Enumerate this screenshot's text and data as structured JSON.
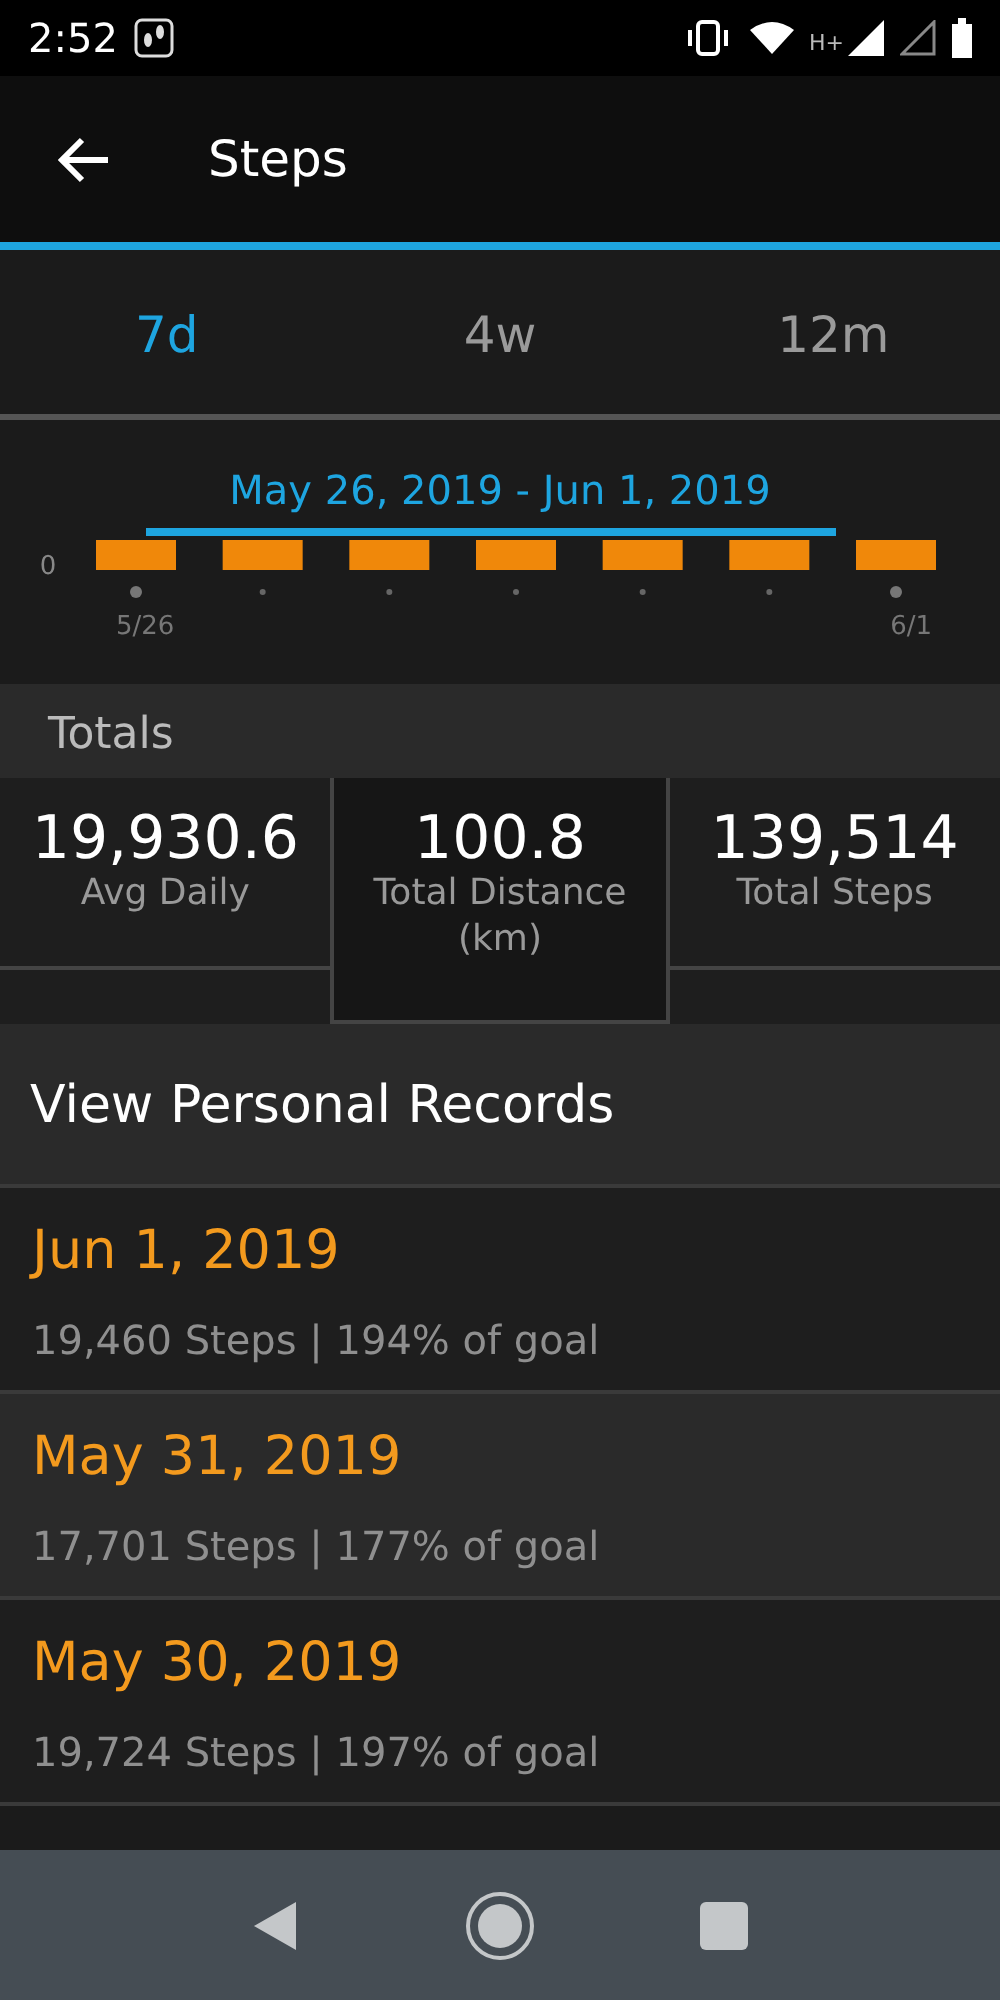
{
  "status_bar": {
    "time": "2:52",
    "network": "H+"
  },
  "app_bar": {
    "title": "Steps"
  },
  "tabs": [
    {
      "label": "7d",
      "selected": true
    },
    {
      "label": "4w",
      "selected": false
    },
    {
      "label": "12m",
      "selected": false
    }
  ],
  "chart": {
    "range": "May 26, 2019 - Jun 1, 2019",
    "y_label": "0",
    "start_label": "5/26",
    "end_label": "6/1"
  },
  "totals": {
    "heading": "Totals",
    "stats": [
      {
        "value": "19,930.6",
        "label": "Avg Daily"
      },
      {
        "value": "100.8",
        "label": "Total Distance (km)"
      },
      {
        "value": "139,514",
        "label": "Total Steps"
      }
    ]
  },
  "records_link": "View Personal Records",
  "days": [
    {
      "date": "Jun 1, 2019",
      "detail": "19,460 Steps | 194% of goal"
    },
    {
      "date": "May 31, 2019",
      "detail": "17,701 Steps | 177% of goal"
    },
    {
      "date": "May 30, 2019",
      "detail": "19,724 Steps | 197% of goal"
    }
  ]
}
